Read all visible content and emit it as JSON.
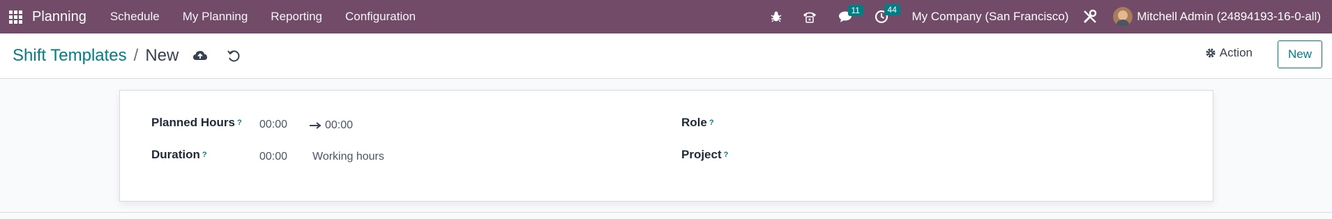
{
  "topbar": {
    "app_name": "Planning",
    "menu": [
      "Schedule",
      "My Planning",
      "Reporting",
      "Configuration"
    ],
    "messages_count": "11",
    "activities_count": "44",
    "company": "My Company (San Francisco)",
    "user": "Mitchell Admin (24894193-16-0-all)",
    "bg_color": "#714b67"
  },
  "breadcrumb": {
    "parent": "Shift Templates",
    "separator": "/",
    "current": "New"
  },
  "actions": {
    "action_label": "Action",
    "new_label": "New"
  },
  "form": {
    "planned_hours_label": "Planned Hours",
    "planned_start": "00:00",
    "planned_end": "00:00",
    "duration_label": "Duration",
    "duration_value": "00:00",
    "duration_unit": "Working hours",
    "role_label": "Role",
    "project_label": "Project",
    "help_mark": "?"
  },
  "accent_color": "#017e84"
}
